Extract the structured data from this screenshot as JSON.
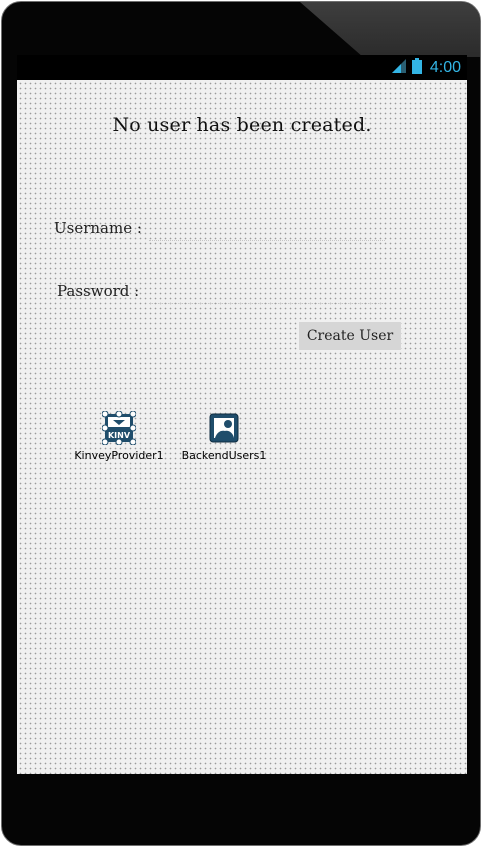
{
  "status_bar": {
    "time": "4:00",
    "icons": [
      "signal-icon",
      "battery-icon"
    ],
    "accent_color": "#33b5e5"
  },
  "form": {
    "status_message": "No user has been created.",
    "username_label": "Username :",
    "username_value": "",
    "password_label": "Password :",
    "password_value": "",
    "create_button": "Create User"
  },
  "components": [
    {
      "label": "KinveyProvider1",
      "icon": "kinvey-provider-icon",
      "icon_text": "KINV"
    },
    {
      "label": "BackendUsers1",
      "icon": "backend-users-icon"
    }
  ]
}
